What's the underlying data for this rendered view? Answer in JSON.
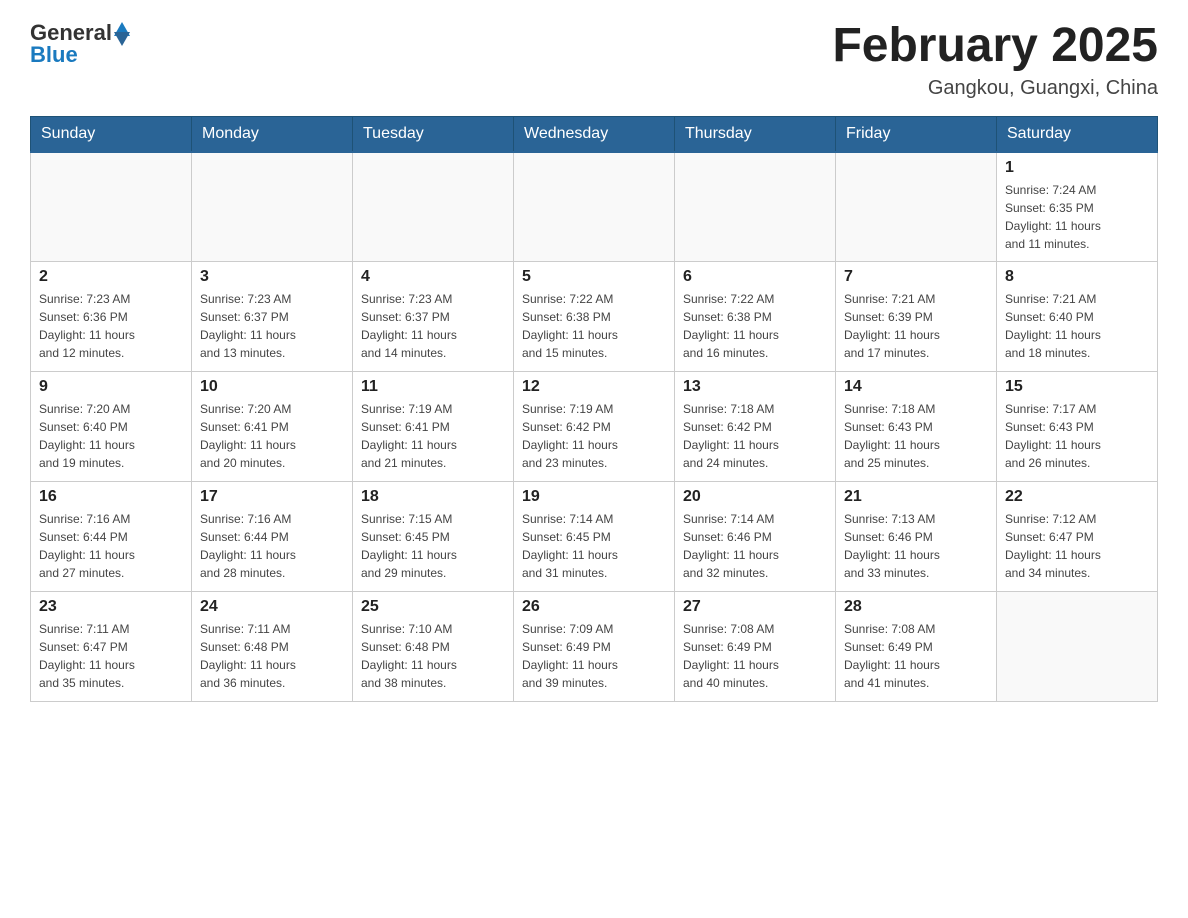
{
  "header": {
    "logo": {
      "general": "General",
      "blue": "Blue"
    },
    "title": "February 2025",
    "subtitle": "Gangkou, Guangxi, China"
  },
  "weekdays": [
    "Sunday",
    "Monday",
    "Tuesday",
    "Wednesday",
    "Thursday",
    "Friday",
    "Saturday"
  ],
  "weeks": [
    [
      {
        "day": "",
        "info": ""
      },
      {
        "day": "",
        "info": ""
      },
      {
        "day": "",
        "info": ""
      },
      {
        "day": "",
        "info": ""
      },
      {
        "day": "",
        "info": ""
      },
      {
        "day": "",
        "info": ""
      },
      {
        "day": "1",
        "info": "Sunrise: 7:24 AM\nSunset: 6:35 PM\nDaylight: 11 hours\nand 11 minutes."
      }
    ],
    [
      {
        "day": "2",
        "info": "Sunrise: 7:23 AM\nSunset: 6:36 PM\nDaylight: 11 hours\nand 12 minutes."
      },
      {
        "day": "3",
        "info": "Sunrise: 7:23 AM\nSunset: 6:37 PM\nDaylight: 11 hours\nand 13 minutes."
      },
      {
        "day": "4",
        "info": "Sunrise: 7:23 AM\nSunset: 6:37 PM\nDaylight: 11 hours\nand 14 minutes."
      },
      {
        "day": "5",
        "info": "Sunrise: 7:22 AM\nSunset: 6:38 PM\nDaylight: 11 hours\nand 15 minutes."
      },
      {
        "day": "6",
        "info": "Sunrise: 7:22 AM\nSunset: 6:38 PM\nDaylight: 11 hours\nand 16 minutes."
      },
      {
        "day": "7",
        "info": "Sunrise: 7:21 AM\nSunset: 6:39 PM\nDaylight: 11 hours\nand 17 minutes."
      },
      {
        "day": "8",
        "info": "Sunrise: 7:21 AM\nSunset: 6:40 PM\nDaylight: 11 hours\nand 18 minutes."
      }
    ],
    [
      {
        "day": "9",
        "info": "Sunrise: 7:20 AM\nSunset: 6:40 PM\nDaylight: 11 hours\nand 19 minutes."
      },
      {
        "day": "10",
        "info": "Sunrise: 7:20 AM\nSunset: 6:41 PM\nDaylight: 11 hours\nand 20 minutes."
      },
      {
        "day": "11",
        "info": "Sunrise: 7:19 AM\nSunset: 6:41 PM\nDaylight: 11 hours\nand 21 minutes."
      },
      {
        "day": "12",
        "info": "Sunrise: 7:19 AM\nSunset: 6:42 PM\nDaylight: 11 hours\nand 23 minutes."
      },
      {
        "day": "13",
        "info": "Sunrise: 7:18 AM\nSunset: 6:42 PM\nDaylight: 11 hours\nand 24 minutes."
      },
      {
        "day": "14",
        "info": "Sunrise: 7:18 AM\nSunset: 6:43 PM\nDaylight: 11 hours\nand 25 minutes."
      },
      {
        "day": "15",
        "info": "Sunrise: 7:17 AM\nSunset: 6:43 PM\nDaylight: 11 hours\nand 26 minutes."
      }
    ],
    [
      {
        "day": "16",
        "info": "Sunrise: 7:16 AM\nSunset: 6:44 PM\nDaylight: 11 hours\nand 27 minutes."
      },
      {
        "day": "17",
        "info": "Sunrise: 7:16 AM\nSunset: 6:44 PM\nDaylight: 11 hours\nand 28 minutes."
      },
      {
        "day": "18",
        "info": "Sunrise: 7:15 AM\nSunset: 6:45 PM\nDaylight: 11 hours\nand 29 minutes."
      },
      {
        "day": "19",
        "info": "Sunrise: 7:14 AM\nSunset: 6:45 PM\nDaylight: 11 hours\nand 31 minutes."
      },
      {
        "day": "20",
        "info": "Sunrise: 7:14 AM\nSunset: 6:46 PM\nDaylight: 11 hours\nand 32 minutes."
      },
      {
        "day": "21",
        "info": "Sunrise: 7:13 AM\nSunset: 6:46 PM\nDaylight: 11 hours\nand 33 minutes."
      },
      {
        "day": "22",
        "info": "Sunrise: 7:12 AM\nSunset: 6:47 PM\nDaylight: 11 hours\nand 34 minutes."
      }
    ],
    [
      {
        "day": "23",
        "info": "Sunrise: 7:11 AM\nSunset: 6:47 PM\nDaylight: 11 hours\nand 35 minutes."
      },
      {
        "day": "24",
        "info": "Sunrise: 7:11 AM\nSunset: 6:48 PM\nDaylight: 11 hours\nand 36 minutes."
      },
      {
        "day": "25",
        "info": "Sunrise: 7:10 AM\nSunset: 6:48 PM\nDaylight: 11 hours\nand 38 minutes."
      },
      {
        "day": "26",
        "info": "Sunrise: 7:09 AM\nSunset: 6:49 PM\nDaylight: 11 hours\nand 39 minutes."
      },
      {
        "day": "27",
        "info": "Sunrise: 7:08 AM\nSunset: 6:49 PM\nDaylight: 11 hours\nand 40 minutes."
      },
      {
        "day": "28",
        "info": "Sunrise: 7:08 AM\nSunset: 6:49 PM\nDaylight: 11 hours\nand 41 minutes."
      },
      {
        "day": "",
        "info": ""
      }
    ]
  ]
}
